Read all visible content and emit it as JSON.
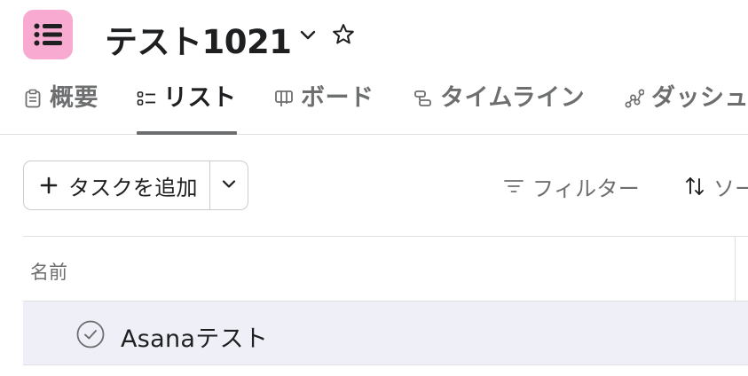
{
  "project": {
    "title": "テスト1021",
    "icon": "list-icon",
    "icon_color": "#f9aad1",
    "icon_glyph_color": "#1e1f21"
  },
  "tabs": [
    {
      "label": "概要",
      "icon": "clipboard-icon",
      "active": false
    },
    {
      "label": "リスト",
      "icon": "list-bullets-icon",
      "active": true
    },
    {
      "label": "ボード",
      "icon": "board-icon",
      "active": false
    },
    {
      "label": "タイムライン",
      "icon": "timeline-icon",
      "active": false
    },
    {
      "label": "ダッシュ",
      "icon": "dashboard-icon",
      "active": false
    }
  ],
  "toolbar": {
    "add_task_label": "タスクを追加",
    "filter_label": "フィルター",
    "sort_label": "ソー"
  },
  "table": {
    "column_name": "名前",
    "rows": [
      {
        "name": "Asanaテスト",
        "completed": false,
        "selected": true
      }
    ]
  },
  "colors": {
    "text": "#1e1f21",
    "muted": "#6d6e6f",
    "border": "#e0e0e0",
    "row_highlight": "#efeff8"
  }
}
